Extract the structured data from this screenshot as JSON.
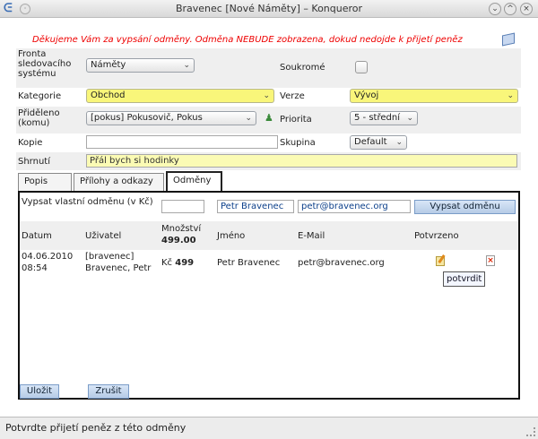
{
  "window": {
    "title": "Bravenec [Nové Náměty] – Konqueror",
    "buttons": [
      "⌄",
      "^",
      "×"
    ]
  },
  "notice": "Děkujeme Vám za vypsání odměny. Odměna NEBUDE zobrazena, dokud nedojde k přijetí peněz",
  "form": {
    "fronta_label": "Fronta sledovacího systému",
    "fronta_value": "Náměty",
    "soukrome_label": "Soukromé",
    "kategorie_label": "Kategorie",
    "kategorie_value": "Obchod",
    "verze_label": "Verze",
    "verze_value": "Vývoj",
    "prideleno_label": "Přiděleno (komu)",
    "prideleno_value": "[pokus] Pokusovič, Pokus",
    "priorita_label": "Priorita",
    "priorita_value": "5 - střední",
    "kopie_label": "Kopie",
    "kopie_value": "",
    "skupina_label": "Skupina",
    "skupina_value": "Default",
    "shrnuti_label": "Shrnutí",
    "shrnuti_value": "Přál bych si hodinky"
  },
  "tabs": [
    {
      "label": "Popis",
      "active": false
    },
    {
      "label": "Přílohy a odkazy",
      "active": false
    },
    {
      "label": "Odměny",
      "active": true
    }
  ],
  "reward": {
    "label": "Vypsat vlastní odměnu (v Kč)",
    "amount_value": "",
    "name_value": "Petr Bravenec",
    "email_value": "petr@bravenec.org",
    "submit_label": "Vypsat odměnu"
  },
  "table": {
    "headers": {
      "datum": "Datum",
      "uzivatel": "Uživatel",
      "mnozstvi": "Množství",
      "mnozstvi_total": "499.00",
      "jmeno": "Jméno",
      "email": "E-Mail",
      "potvrzeno": "Potvrzeno"
    },
    "rows": [
      {
        "datum_date": "04.06.2010",
        "datum_time": "08:54",
        "uzivatel_login": "[bravenec]",
        "uzivatel_name": "Bravenec, Petr",
        "mnozstvi_currency": "Kč",
        "mnozstvi_value": "499",
        "jmeno": "Petr Bravenec",
        "email": "petr@bravenec.org"
      }
    ]
  },
  "tooltip": "potvrdit",
  "footer": {
    "save_label": "Uložit",
    "cancel_label": "Zrušit"
  },
  "status": "Potvrdte přijetí peněz z této odměny"
}
